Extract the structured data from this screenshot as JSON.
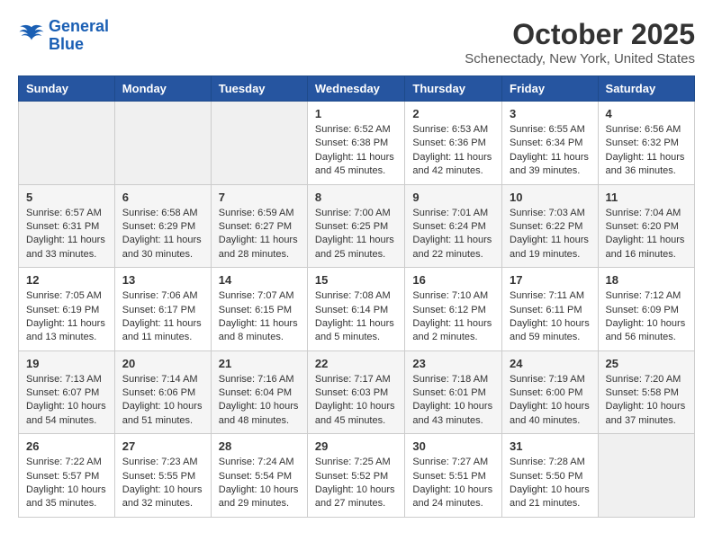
{
  "header": {
    "logo_line1": "General",
    "logo_line2": "Blue",
    "month": "October 2025",
    "location": "Schenectady, New York, United States"
  },
  "days_of_week": [
    "Sunday",
    "Monday",
    "Tuesday",
    "Wednesday",
    "Thursday",
    "Friday",
    "Saturday"
  ],
  "weeks": [
    [
      {
        "day": "",
        "content": ""
      },
      {
        "day": "",
        "content": ""
      },
      {
        "day": "",
        "content": ""
      },
      {
        "day": "1",
        "content": "Sunrise: 6:52 AM\nSunset: 6:38 PM\nDaylight: 11 hours and 45 minutes."
      },
      {
        "day": "2",
        "content": "Sunrise: 6:53 AM\nSunset: 6:36 PM\nDaylight: 11 hours and 42 minutes."
      },
      {
        "day": "3",
        "content": "Sunrise: 6:55 AM\nSunset: 6:34 PM\nDaylight: 11 hours and 39 minutes."
      },
      {
        "day": "4",
        "content": "Sunrise: 6:56 AM\nSunset: 6:32 PM\nDaylight: 11 hours and 36 minutes."
      }
    ],
    [
      {
        "day": "5",
        "content": "Sunrise: 6:57 AM\nSunset: 6:31 PM\nDaylight: 11 hours and 33 minutes."
      },
      {
        "day": "6",
        "content": "Sunrise: 6:58 AM\nSunset: 6:29 PM\nDaylight: 11 hours and 30 minutes."
      },
      {
        "day": "7",
        "content": "Sunrise: 6:59 AM\nSunset: 6:27 PM\nDaylight: 11 hours and 28 minutes."
      },
      {
        "day": "8",
        "content": "Sunrise: 7:00 AM\nSunset: 6:25 PM\nDaylight: 11 hours and 25 minutes."
      },
      {
        "day": "9",
        "content": "Sunrise: 7:01 AM\nSunset: 6:24 PM\nDaylight: 11 hours and 22 minutes."
      },
      {
        "day": "10",
        "content": "Sunrise: 7:03 AM\nSunset: 6:22 PM\nDaylight: 11 hours and 19 minutes."
      },
      {
        "day": "11",
        "content": "Sunrise: 7:04 AM\nSunset: 6:20 PM\nDaylight: 11 hours and 16 minutes."
      }
    ],
    [
      {
        "day": "12",
        "content": "Sunrise: 7:05 AM\nSunset: 6:19 PM\nDaylight: 11 hours and 13 minutes."
      },
      {
        "day": "13",
        "content": "Sunrise: 7:06 AM\nSunset: 6:17 PM\nDaylight: 11 hours and 11 minutes."
      },
      {
        "day": "14",
        "content": "Sunrise: 7:07 AM\nSunset: 6:15 PM\nDaylight: 11 hours and 8 minutes."
      },
      {
        "day": "15",
        "content": "Sunrise: 7:08 AM\nSunset: 6:14 PM\nDaylight: 11 hours and 5 minutes."
      },
      {
        "day": "16",
        "content": "Sunrise: 7:10 AM\nSunset: 6:12 PM\nDaylight: 11 hours and 2 minutes."
      },
      {
        "day": "17",
        "content": "Sunrise: 7:11 AM\nSunset: 6:11 PM\nDaylight: 10 hours and 59 minutes."
      },
      {
        "day": "18",
        "content": "Sunrise: 7:12 AM\nSunset: 6:09 PM\nDaylight: 10 hours and 56 minutes."
      }
    ],
    [
      {
        "day": "19",
        "content": "Sunrise: 7:13 AM\nSunset: 6:07 PM\nDaylight: 10 hours and 54 minutes."
      },
      {
        "day": "20",
        "content": "Sunrise: 7:14 AM\nSunset: 6:06 PM\nDaylight: 10 hours and 51 minutes."
      },
      {
        "day": "21",
        "content": "Sunrise: 7:16 AM\nSunset: 6:04 PM\nDaylight: 10 hours and 48 minutes."
      },
      {
        "day": "22",
        "content": "Sunrise: 7:17 AM\nSunset: 6:03 PM\nDaylight: 10 hours and 45 minutes."
      },
      {
        "day": "23",
        "content": "Sunrise: 7:18 AM\nSunset: 6:01 PM\nDaylight: 10 hours and 43 minutes."
      },
      {
        "day": "24",
        "content": "Sunrise: 7:19 AM\nSunset: 6:00 PM\nDaylight: 10 hours and 40 minutes."
      },
      {
        "day": "25",
        "content": "Sunrise: 7:20 AM\nSunset: 5:58 PM\nDaylight: 10 hours and 37 minutes."
      }
    ],
    [
      {
        "day": "26",
        "content": "Sunrise: 7:22 AM\nSunset: 5:57 PM\nDaylight: 10 hours and 35 minutes."
      },
      {
        "day": "27",
        "content": "Sunrise: 7:23 AM\nSunset: 5:55 PM\nDaylight: 10 hours and 32 minutes."
      },
      {
        "day": "28",
        "content": "Sunrise: 7:24 AM\nSunset: 5:54 PM\nDaylight: 10 hours and 29 minutes."
      },
      {
        "day": "29",
        "content": "Sunrise: 7:25 AM\nSunset: 5:52 PM\nDaylight: 10 hours and 27 minutes."
      },
      {
        "day": "30",
        "content": "Sunrise: 7:27 AM\nSunset: 5:51 PM\nDaylight: 10 hours and 24 minutes."
      },
      {
        "day": "31",
        "content": "Sunrise: 7:28 AM\nSunset: 5:50 PM\nDaylight: 10 hours and 21 minutes."
      },
      {
        "day": "",
        "content": ""
      }
    ]
  ]
}
